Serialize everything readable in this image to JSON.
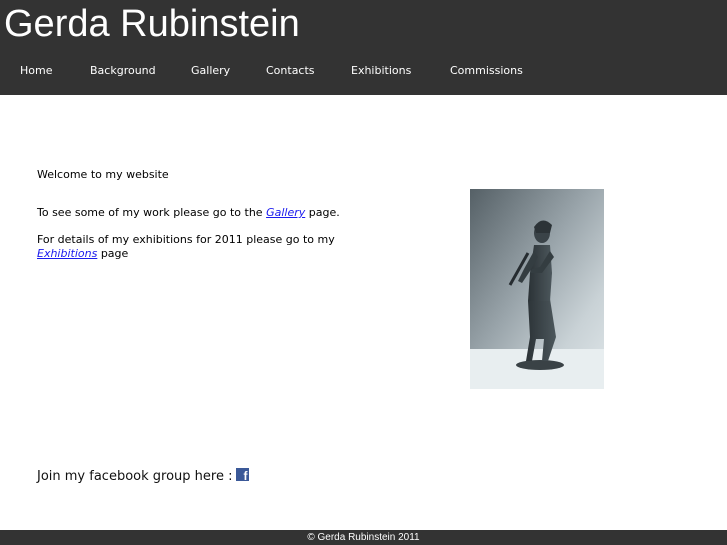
{
  "site": {
    "title": "Gerda Rubinstein"
  },
  "nav": {
    "items": [
      {
        "label": "Home"
      },
      {
        "label": "Background"
      },
      {
        "label": "Gallery"
      },
      {
        "label": "Contacts"
      },
      {
        "label": "Exhibitions"
      },
      {
        "label": "Commissions"
      }
    ]
  },
  "main": {
    "welcome": "Welcome to my website",
    "gallery_text_before": "To see some of my work please go to the ",
    "gallery_link": "Gallery",
    "gallery_text_after": " page.",
    "exhibitions_text_before": "For details of my exhibitions for 2011 please go to my ",
    "exhibitions_link": "Exhibitions",
    "exhibitions_text_after": " page",
    "link_color": "#1a1aee"
  },
  "facebook": {
    "text": "Join my facebook group here :",
    "icon": "facebook-icon",
    "icon_color": "#3b5998"
  },
  "footer": {
    "copyright": "© Gerda Rubinstein 2011"
  },
  "colors": {
    "header_bg": "#333333",
    "footer_bg": "#333333"
  }
}
